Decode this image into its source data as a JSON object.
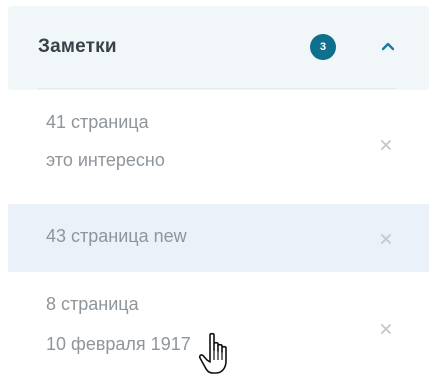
{
  "notes_panel": {
    "title": "Заметки",
    "count": "3",
    "collapse_icon": "chevron-up-icon",
    "accent_color": "#0f6f8c",
    "items": [
      {
        "line1": "41 страница",
        "line2": "это интересно",
        "selected": false,
        "remove_icon": "close-icon"
      },
      {
        "line1": "43 страница  new",
        "line2": "",
        "selected": true,
        "remove_icon": "close-icon"
      },
      {
        "line1": "8 страница",
        "line2": "10 февраля 1917",
        "selected": false,
        "remove_icon": "close-icon"
      }
    ]
  }
}
